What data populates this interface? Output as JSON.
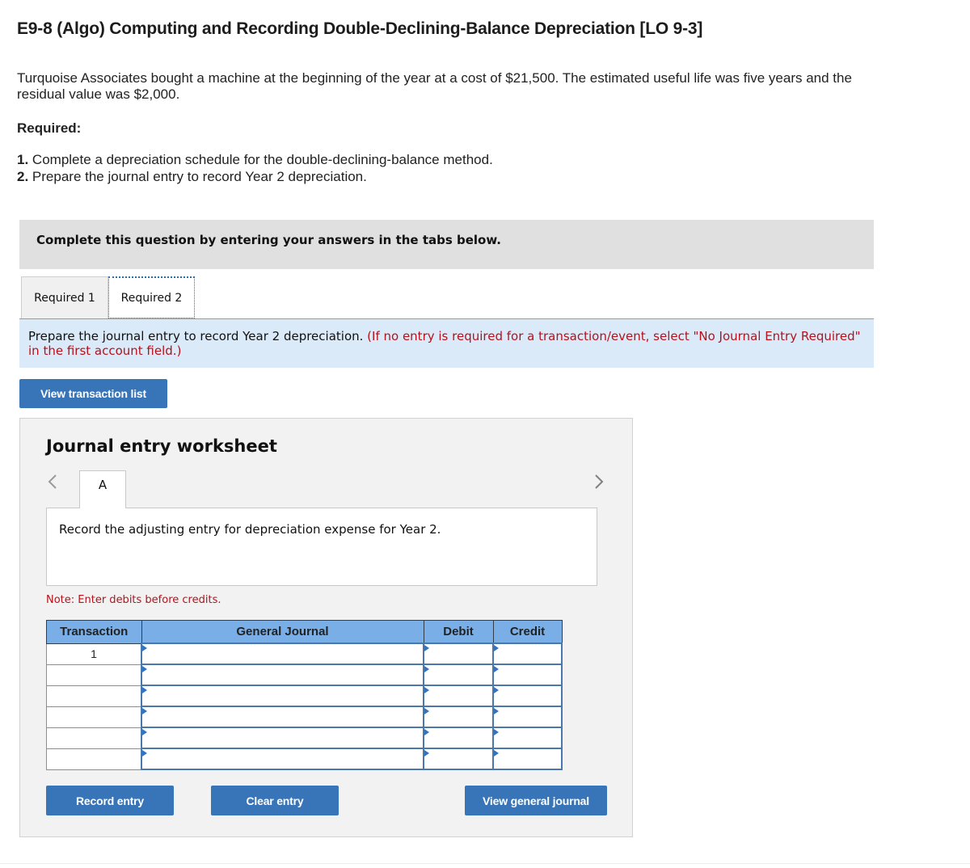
{
  "problem": {
    "title": "E9-8 (Algo) Computing and Recording Double-Declining-Balance Depreciation [LO 9-3]",
    "intro": "Turquoise Associates bought a machine at the beginning of the year at a cost of $21,500. The estimated useful life was five years and the residual value was $2,000.",
    "required_label": "Required:",
    "requirements": [
      {
        "num": "1.",
        "text": "Complete a depreciation schedule for the double-declining-balance method."
      },
      {
        "num": "2.",
        "text": "Prepare the journal entry to record Year 2 depreciation."
      }
    ]
  },
  "banner": {
    "text": "Complete this question by entering your answers in the tabs below."
  },
  "tabs": [
    {
      "label": "Required 1",
      "active": false
    },
    {
      "label": "Required 2",
      "active": true
    }
  ],
  "instructions": {
    "main": "Prepare the journal entry to record Year 2 depreciation.",
    "note": "(If no entry is required for a transaction/event, select \"No Journal Entry Required\" in the first account field.)"
  },
  "buttons": {
    "view_transaction_list": "View transaction list",
    "record_entry": "Record entry",
    "clear_entry": "Clear entry",
    "view_general_journal": "View general journal"
  },
  "worksheet": {
    "title": "Journal entry worksheet",
    "prev_icon": "chevron-left-icon",
    "next_icon": "chevron-right-icon",
    "active_tab": "A",
    "description": "Record the adjusting entry for depreciation expense for Year 2.",
    "note": "Note: Enter debits before credits.",
    "table": {
      "headers": [
        "Transaction",
        "General Journal",
        "Debit",
        "Credit"
      ],
      "rows": [
        {
          "transaction": "1",
          "account": "",
          "debit": "",
          "credit": ""
        },
        {
          "transaction": "",
          "account": "",
          "debit": "",
          "credit": ""
        },
        {
          "transaction": "",
          "account": "",
          "debit": "",
          "credit": ""
        },
        {
          "transaction": "",
          "account": "",
          "debit": "",
          "credit": ""
        },
        {
          "transaction": "",
          "account": "",
          "debit": "",
          "credit": ""
        },
        {
          "transaction": "",
          "account": "",
          "debit": "",
          "credit": ""
        }
      ]
    }
  },
  "colors": {
    "button": "#3875b8",
    "table_header": "#7aaee6",
    "instruction_bg": "#dbeaf8",
    "note_red": "#b5121b"
  }
}
